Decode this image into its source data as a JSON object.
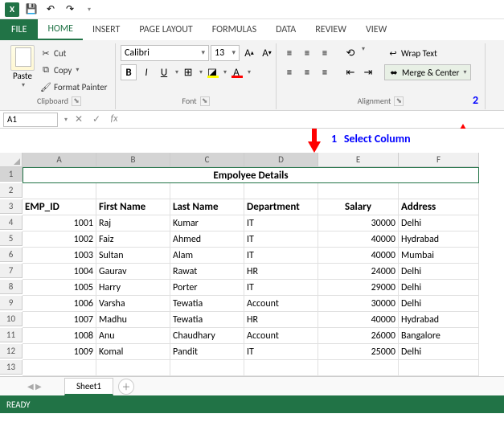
{
  "qat": {
    "save": "💾",
    "undo": "↶",
    "redo": "↷"
  },
  "tabs": {
    "file": "FILE",
    "home": "HOME",
    "insert": "INSERT",
    "pagelayout": "PAGE LAYOUT",
    "formulas": "FORMULAS",
    "data": "DATA",
    "review": "REVIEW",
    "view": "VIEW"
  },
  "ribbon": {
    "clipboard": {
      "label": "Clipboard",
      "paste": "Paste",
      "cut": "Cut",
      "copy": "Copy",
      "format_painter": "Format Painter"
    },
    "font": {
      "label": "Font",
      "name": "Calibri",
      "size": "13",
      "bold": "B",
      "italic": "I",
      "underline": "U"
    },
    "alignment": {
      "label": "Alignment",
      "wrap": "Wrap Text",
      "merge": "Merge & Center"
    }
  },
  "namebox": "A1",
  "annotations": {
    "one": "1",
    "one_text": "Select Column",
    "two": "2"
  },
  "columns": [
    "A",
    "B",
    "C",
    "D",
    "E",
    "F"
  ],
  "rows": [
    "1",
    "2",
    "3",
    "4",
    "5",
    "6",
    "7",
    "8",
    "9",
    "10",
    "11",
    "12",
    "13"
  ],
  "grid": {
    "title": "Empolyee Details",
    "headers": {
      "a": "EMP_ID",
      "b": "First Name",
      "c": "Last Name",
      "d": "Department",
      "e": "Salary",
      "f": "Address"
    },
    "data": [
      {
        "a": "1001",
        "b": "Raj",
        "c": "Kumar",
        "d": "IT",
        "e": "30000",
        "f": "Delhi"
      },
      {
        "a": "1002",
        "b": "Faiz",
        "c": "Ahmed",
        "d": "IT",
        "e": "40000",
        "f": "Hydrabad"
      },
      {
        "a": "1003",
        "b": "Sultan",
        "c": "Alam",
        "d": "IT",
        "e": "40000",
        "f": "Mumbai"
      },
      {
        "a": "1004",
        "b": "Gaurav",
        "c": "Rawat",
        "d": "HR",
        "e": "24000",
        "f": "Delhi"
      },
      {
        "a": "1005",
        "b": "Harry",
        "c": "Porter",
        "d": "IT",
        "e": "29000",
        "f": "Delhi"
      },
      {
        "a": "1006",
        "b": "Varsha",
        "c": "Tewatia",
        "d": "Account",
        "e": "30000",
        "f": "Delhi"
      },
      {
        "a": "1007",
        "b": "Madhu",
        "c": "Tewatia",
        "d": "HR",
        "e": "40000",
        "f": "Hydrabad"
      },
      {
        "a": "1008",
        "b": "Anu",
        "c": "Chaudhary",
        "d": "Account",
        "e": "26000",
        "f": "Bangalore"
      },
      {
        "a": "1009",
        "b": "Komal",
        "c": "Pandit",
        "d": "IT",
        "e": "25000",
        "f": "Delhi"
      }
    ]
  },
  "sheet_tab": "Sheet1",
  "status": "READY"
}
